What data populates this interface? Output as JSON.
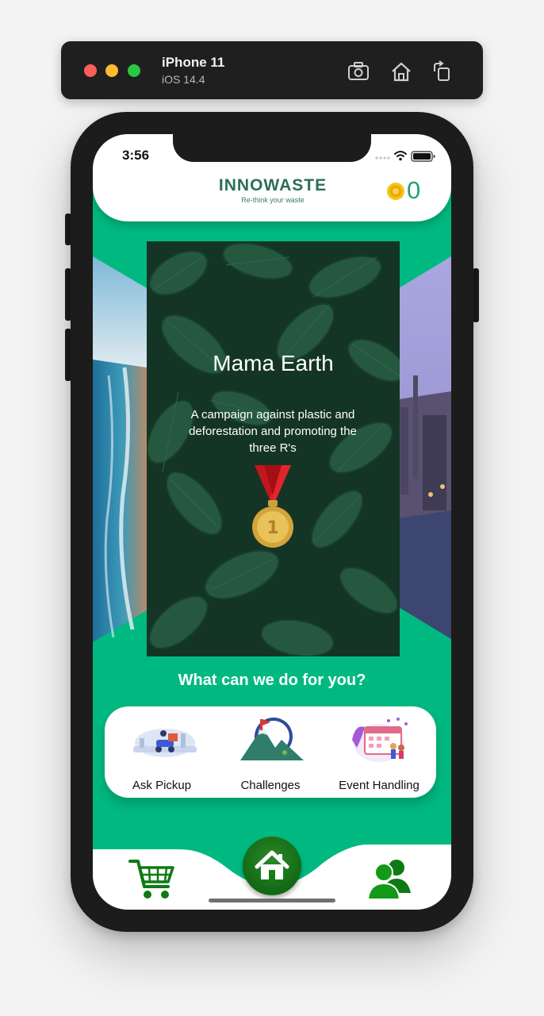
{
  "simulator": {
    "device_name": "iPhone 11",
    "os_version": "iOS 14.4",
    "toolbar_icons": [
      "screenshot-icon",
      "home-icon",
      "rotate-icon"
    ]
  },
  "status_bar": {
    "time": "3:56"
  },
  "header": {
    "brand": "INNOWASTE",
    "tagline": "Re-think your waste",
    "points": "0"
  },
  "carousel": {
    "active_card": {
      "title": "Mama Earth",
      "description": "A campaign against plastic and deforestation and promoting the three R's",
      "badge": "gold-medal"
    }
  },
  "services": {
    "title": "What can we do for you?",
    "items": [
      {
        "label": "Ask Pickup"
      },
      {
        "label": "Challenges"
      },
      {
        "label": "Event Handling"
      }
    ]
  },
  "bottom_nav": {
    "items": [
      "cart-icon",
      "home-icon",
      "people-icon"
    ]
  },
  "colors": {
    "primary": "#00b980",
    "brand_text": "#2c6e58",
    "points_text": "#1fa37c",
    "nav_icon": "#0e7a12"
  }
}
